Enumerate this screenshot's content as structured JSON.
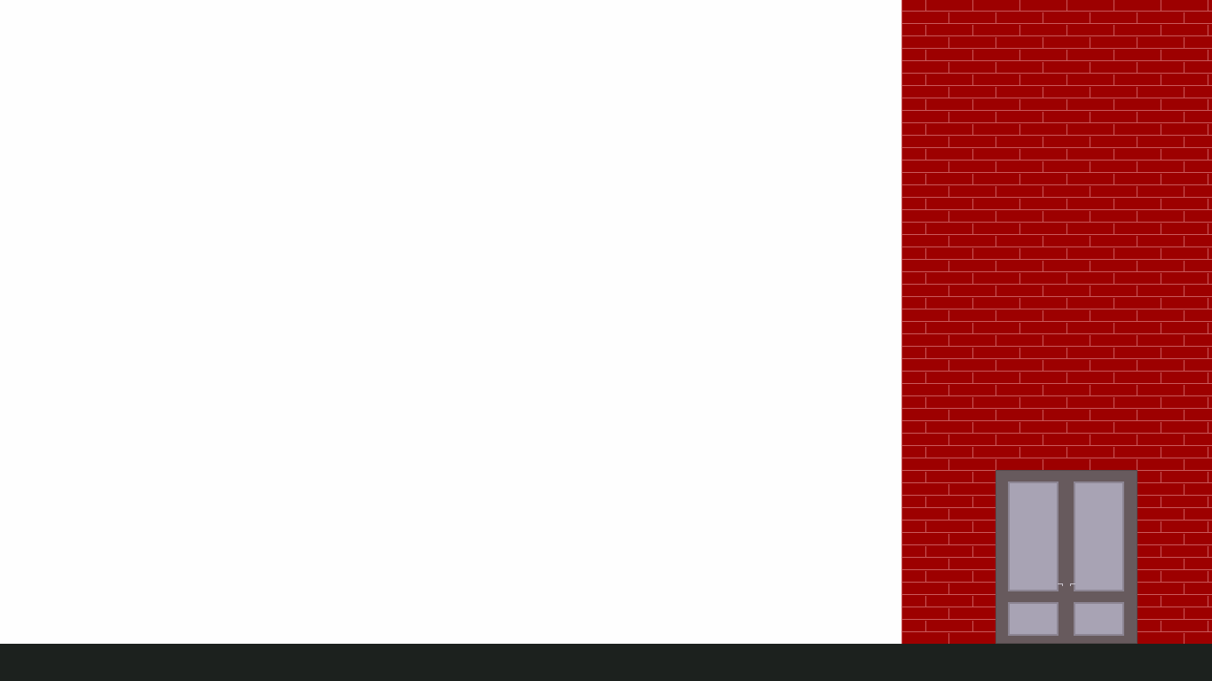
{
  "scene": {
    "colors": {
      "sky": "#fefefe",
      "brick": "#9d0000",
      "mortar": "#c9595a",
      "door_frame": "#675a5d",
      "door_glass": "#a8a3b4",
      "door_glass_edge": "#8c8593",
      "door_handle": "#c8c3cc",
      "ground": "#1c211e"
    },
    "building": {
      "material": "brick-wall-icon"
    },
    "door": {
      "type": "double-door-icon",
      "panes_per_leaf": 2
    }
  }
}
